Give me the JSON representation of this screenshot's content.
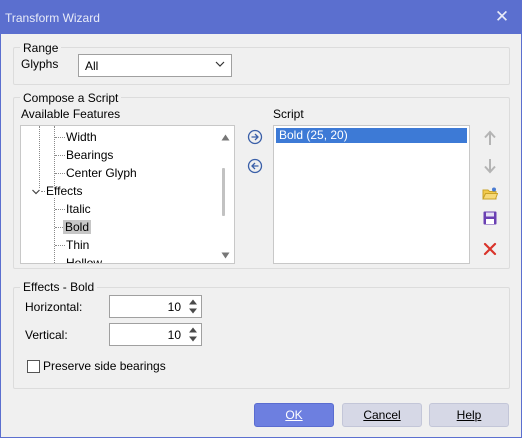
{
  "window": {
    "title": "Transform Wizard",
    "accent_color": "#5b6fcf"
  },
  "range": {
    "legend": "Range",
    "glyphs_label": "Glyphs",
    "glyphs_value": "All"
  },
  "compose": {
    "legend": "Compose a Script",
    "available_label": "Available Features",
    "script_label": "Script",
    "tree": [
      {
        "label": "Width",
        "level": 2
      },
      {
        "label": "Bearings",
        "level": 2
      },
      {
        "label": "Center Glyph",
        "level": 2
      },
      {
        "label": "Effects",
        "level": 1,
        "expanded": true
      },
      {
        "label": "Italic",
        "level": 2
      },
      {
        "label": "Bold",
        "level": 2,
        "selected": true
      },
      {
        "label": "Thin",
        "level": 2
      },
      {
        "label": "Hollow",
        "level": 2
      }
    ],
    "script_items": [
      "Bold (25, 20)"
    ],
    "icons": {
      "add": "arrow-right-circle-icon",
      "remove": "arrow-left-circle-icon",
      "up": "arrow-up-icon",
      "down": "arrow-down-icon",
      "open": "open-folder-icon",
      "save": "save-icon",
      "delete": "delete-x-icon"
    }
  },
  "effects": {
    "legend": "Effects - Bold",
    "horizontal_label": "Horizontal:",
    "horizontal_value": "10",
    "vertical_label": "Vertical:",
    "vertical_value": "10",
    "preserve_label": "Preserve side bearings",
    "preserve_checked": false
  },
  "buttons": {
    "ok": "OK",
    "cancel": "Cancel",
    "help": "Help"
  }
}
